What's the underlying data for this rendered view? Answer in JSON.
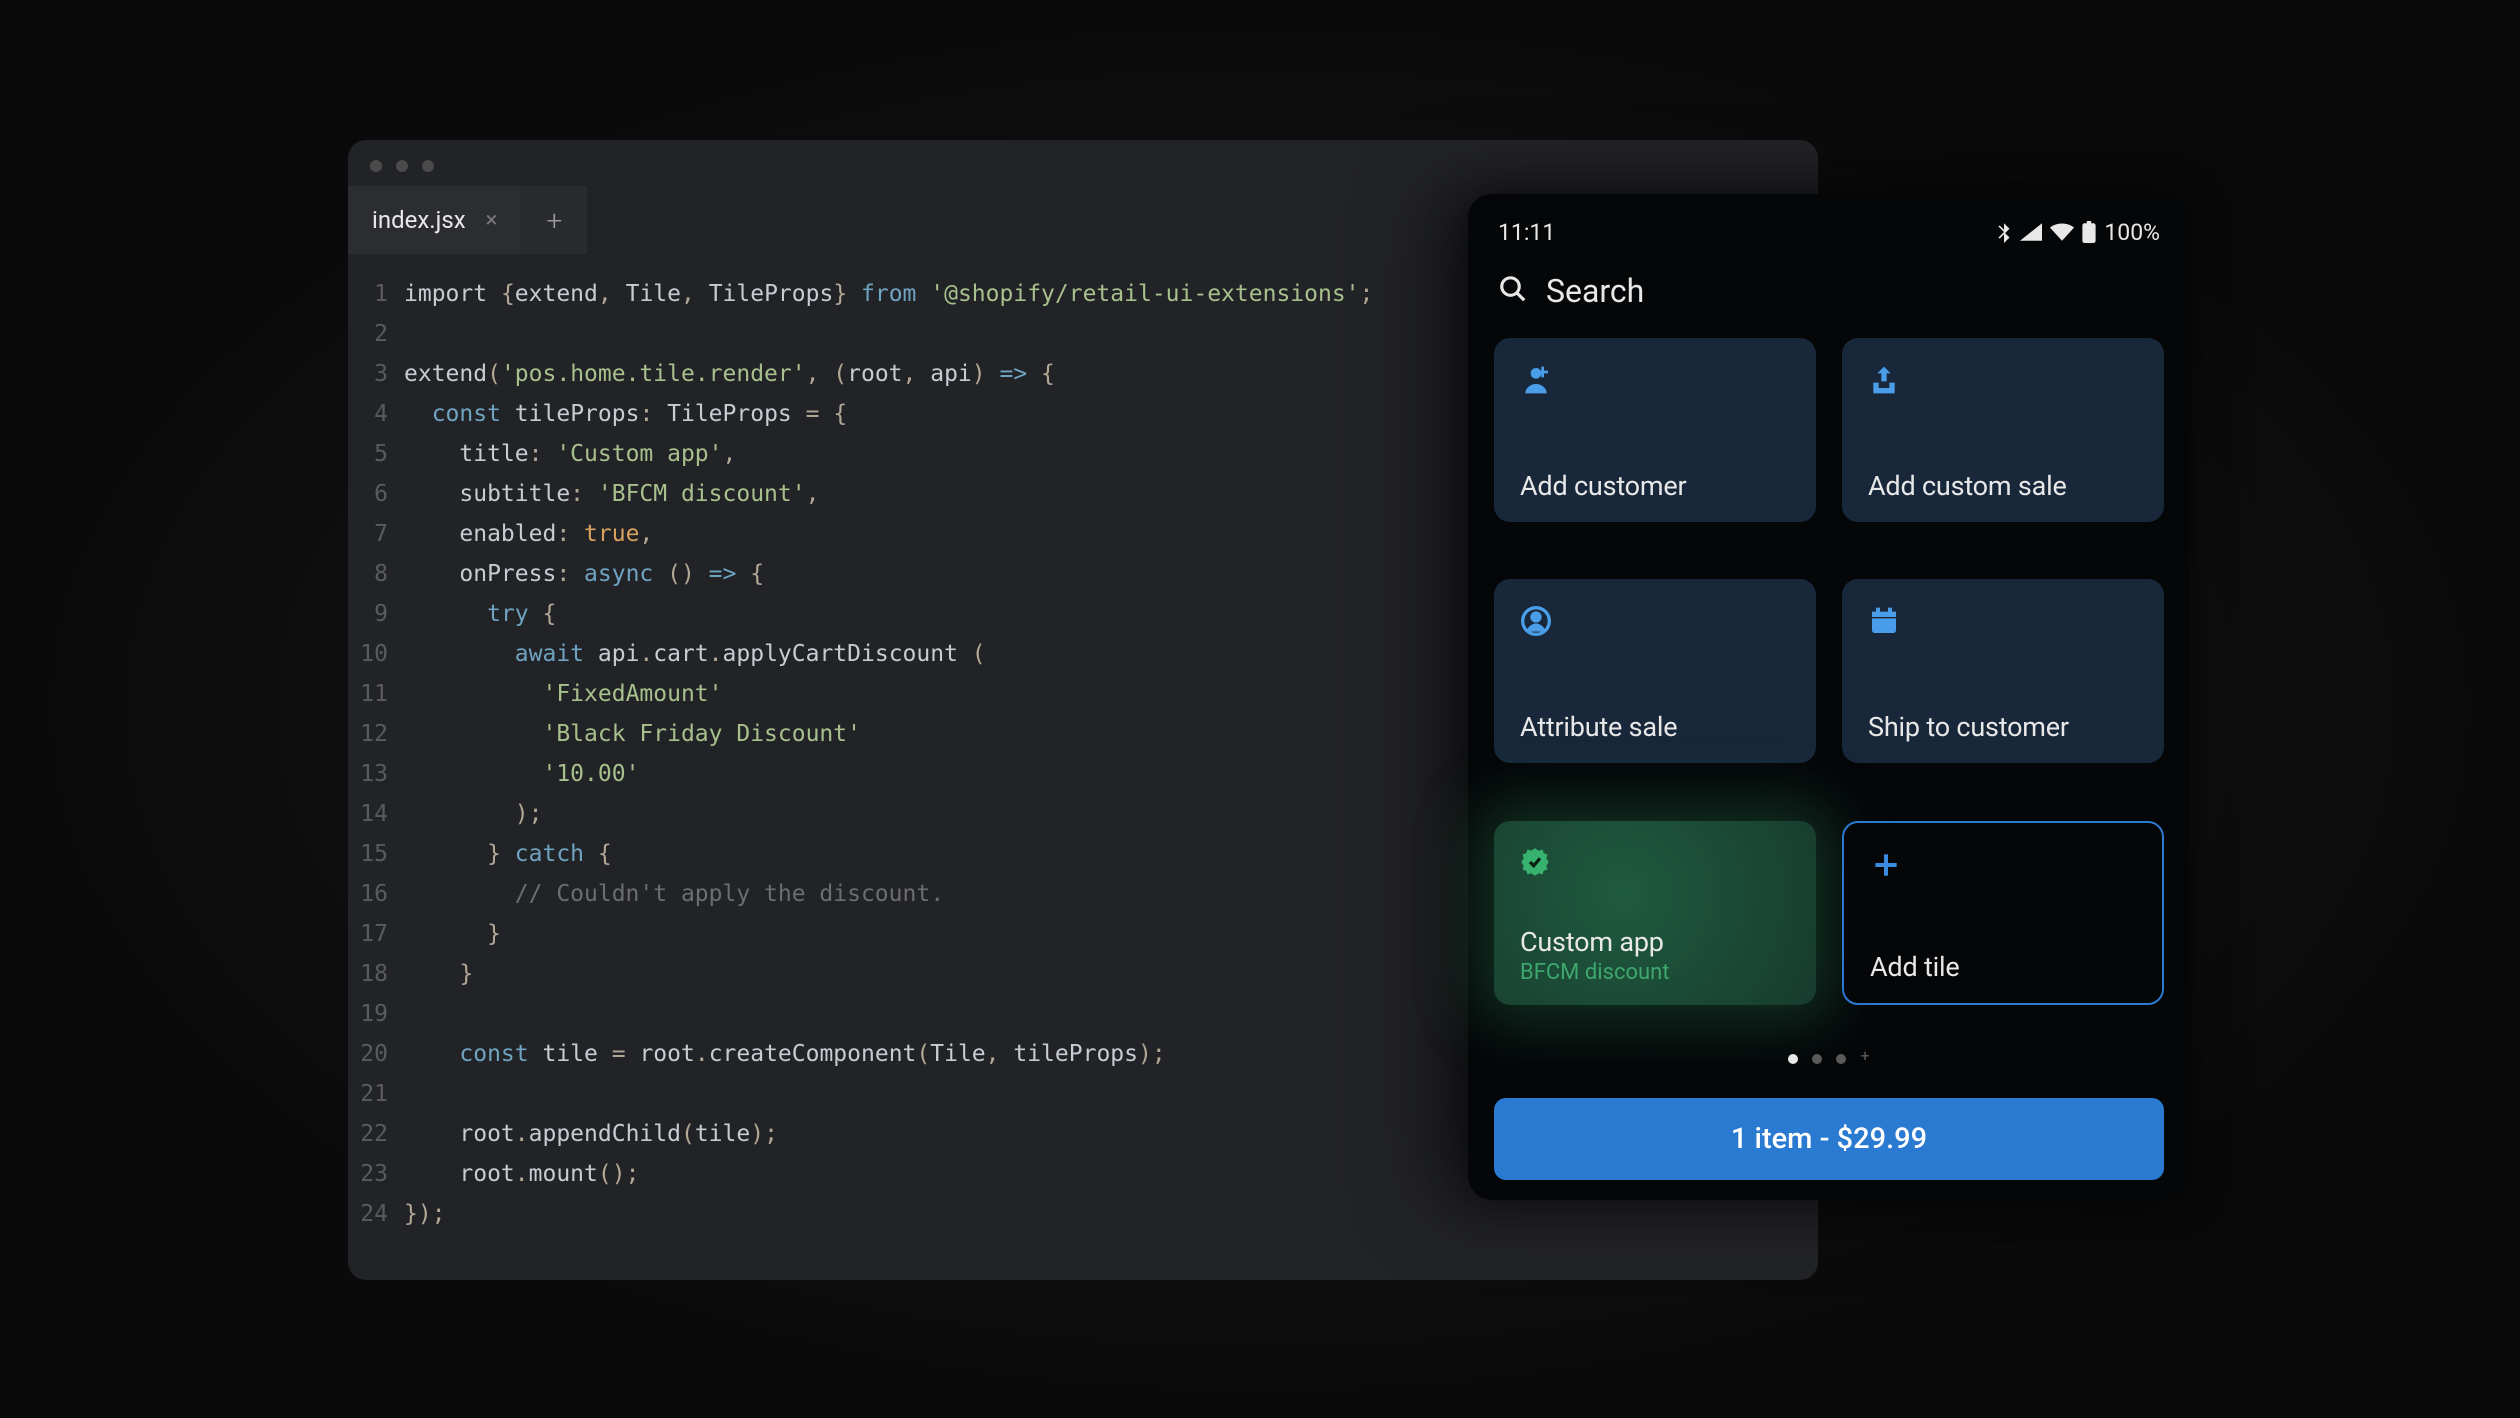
{
  "editor": {
    "tab": "index.jsx",
    "lines": [
      {
        "n": "1",
        "seg": [
          [
            "c-a",
            "import "
          ],
          [
            "c-b",
            "{"
          ],
          [
            "c-a",
            "extend"
          ],
          [
            "c-b",
            ", "
          ],
          [
            "c-a",
            "Tile"
          ],
          [
            "c-b",
            ", "
          ],
          [
            "c-a",
            "TileProps"
          ],
          [
            "c-b",
            "} "
          ],
          [
            "c-d",
            "from "
          ],
          [
            "c-c",
            "'@shopify/retail-ui-extensions'"
          ],
          [
            "c-b",
            ";"
          ]
        ]
      },
      {
        "n": "2",
        "seg": [
          [
            "c-a",
            ""
          ]
        ]
      },
      {
        "n": "3",
        "seg": [
          [
            "c-a",
            "extend"
          ],
          [
            "c-b",
            "("
          ],
          [
            "c-c",
            "'pos.home.tile.render'"
          ],
          [
            "c-b",
            ", ("
          ],
          [
            "c-a",
            "root"
          ],
          [
            "c-b",
            ", "
          ],
          [
            "c-a",
            "api"
          ],
          [
            "c-b",
            ") "
          ],
          [
            "c-d",
            "=>"
          ],
          [
            "c-b",
            " {"
          ]
        ]
      },
      {
        "n": "4",
        "seg": [
          [
            "c-a",
            "  "
          ],
          [
            "c-d",
            "const"
          ],
          [
            "c-a",
            " tileProps"
          ],
          [
            "c-b",
            ": "
          ],
          [
            "c-a",
            "TileProps "
          ],
          [
            "c-b",
            "= {"
          ]
        ]
      },
      {
        "n": "5",
        "seg": [
          [
            "c-a",
            "    title"
          ],
          [
            "c-b",
            ": "
          ],
          [
            "c-c",
            "'Custom app'"
          ],
          [
            "c-b",
            ","
          ]
        ]
      },
      {
        "n": "6",
        "seg": [
          [
            "c-a",
            "    subtitle"
          ],
          [
            "c-b",
            ": "
          ],
          [
            "c-c",
            "'BFCM discount'"
          ],
          [
            "c-b",
            ","
          ]
        ]
      },
      {
        "n": "7",
        "seg": [
          [
            "c-a",
            "    enabled"
          ],
          [
            "c-b",
            ": "
          ],
          [
            "c-e",
            "true"
          ],
          [
            "c-b",
            ","
          ]
        ]
      },
      {
        "n": "8",
        "seg": [
          [
            "c-a",
            "    onPress"
          ],
          [
            "c-b",
            ": "
          ],
          [
            "c-d",
            "async"
          ],
          [
            "c-b",
            " () "
          ],
          [
            "c-d",
            "=>"
          ],
          [
            "c-b",
            " {"
          ]
        ]
      },
      {
        "n": "9",
        "seg": [
          [
            "c-a",
            "      "
          ],
          [
            "c-d",
            "try"
          ],
          [
            "c-b",
            " {"
          ]
        ]
      },
      {
        "n": "10",
        "seg": [
          [
            "c-a",
            "        "
          ],
          [
            "c-d",
            "await"
          ],
          [
            "c-a",
            " api"
          ],
          [
            "c-b",
            "."
          ],
          [
            "c-a",
            "cart"
          ],
          [
            "c-b",
            "."
          ],
          [
            "c-a",
            "applyCartDiscount "
          ],
          [
            "c-b",
            "("
          ]
        ]
      },
      {
        "n": "11",
        "seg": [
          [
            "c-a",
            "          "
          ],
          [
            "c-c",
            "'FixedAmount'"
          ]
        ]
      },
      {
        "n": "12",
        "seg": [
          [
            "c-a",
            "          "
          ],
          [
            "c-c",
            "'Black Friday Discount'"
          ]
        ]
      },
      {
        "n": "13",
        "seg": [
          [
            "c-a",
            "          "
          ],
          [
            "c-c",
            "'10.00'"
          ]
        ]
      },
      {
        "n": "14",
        "seg": [
          [
            "c-a",
            "        "
          ],
          [
            "c-b",
            ");"
          ]
        ]
      },
      {
        "n": "15",
        "seg": [
          [
            "c-a",
            "      "
          ],
          [
            "c-b",
            "} "
          ],
          [
            "c-d",
            "catch"
          ],
          [
            "c-b",
            " {"
          ]
        ]
      },
      {
        "n": "16",
        "seg": [
          [
            "c-a",
            "        "
          ],
          [
            "c-f",
            "// Couldn't apply the discount."
          ]
        ]
      },
      {
        "n": "17",
        "seg": [
          [
            "c-a",
            "      "
          ],
          [
            "c-b",
            "}"
          ]
        ]
      },
      {
        "n": "18",
        "seg": [
          [
            "c-a",
            "    "
          ],
          [
            "c-b",
            "}"
          ]
        ]
      },
      {
        "n": "19",
        "seg": [
          [
            "c-a",
            ""
          ]
        ]
      },
      {
        "n": "20",
        "seg": [
          [
            "c-a",
            "    "
          ],
          [
            "c-d",
            "const"
          ],
          [
            "c-a",
            " tile "
          ],
          [
            "c-b",
            "= "
          ],
          [
            "c-a",
            "root"
          ],
          [
            "c-b",
            "."
          ],
          [
            "c-a",
            "createComponent"
          ],
          [
            "c-b",
            "("
          ],
          [
            "c-a",
            "Tile"
          ],
          [
            "c-b",
            ", "
          ],
          [
            "c-a",
            "tileProps"
          ],
          [
            "c-b",
            ");"
          ]
        ]
      },
      {
        "n": "21",
        "seg": [
          [
            "c-a",
            ""
          ]
        ]
      },
      {
        "n": "22",
        "seg": [
          [
            "c-a",
            "    root"
          ],
          [
            "c-b",
            "."
          ],
          [
            "c-a",
            "appendChild"
          ],
          [
            "c-b",
            "("
          ],
          [
            "c-a",
            "tile"
          ],
          [
            "c-b",
            ");"
          ]
        ]
      },
      {
        "n": "23",
        "seg": [
          [
            "c-a",
            "    root"
          ],
          [
            "c-b",
            "."
          ],
          [
            "c-a",
            "mount"
          ],
          [
            "c-b",
            "();"
          ]
        ]
      },
      {
        "n": "24",
        "seg": [
          [
            "c-b",
            "});"
          ]
        ]
      }
    ]
  },
  "phone": {
    "time": "11:11",
    "battery": "100%",
    "search": "Search",
    "cart": "1 item - $29.99",
    "tiles": [
      {
        "title": "Add customer",
        "icon": "person"
      },
      {
        "title": "Add custom sale",
        "icon": "upload"
      },
      {
        "title": "Attribute sale",
        "icon": "person-circle"
      },
      {
        "title": "Ship to customer",
        "icon": "calendar"
      },
      {
        "title": "Custom app",
        "subtitle": "BFCM discount",
        "variant": "green",
        "icon": "badge"
      },
      {
        "title": "Add tile",
        "variant": "outline",
        "icon": "plus"
      }
    ]
  }
}
